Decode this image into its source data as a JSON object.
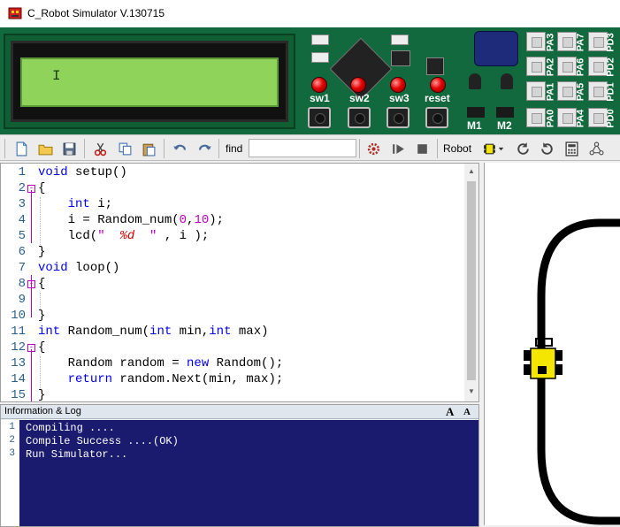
{
  "window": {
    "title": "C_Robot Simulator V.130715"
  },
  "board": {
    "switch_labels": [
      "sw1",
      "sw2",
      "sw3",
      "reset"
    ],
    "port_labels_top": [
      "PA3",
      "PA7",
      "PD3"
    ],
    "port_labels_mid": [
      "PA2",
      "PA6",
      "PD2"
    ],
    "port_labels_bottom": [
      "PA1",
      "PA5",
      "PD1"
    ],
    "port_labels_last": [
      "PA0",
      "PA4",
      "PD0"
    ],
    "motor_labels": [
      "M1",
      "M2"
    ],
    "lcd_cursor": "I"
  },
  "toolbar": {
    "find_label": "find",
    "find_value": "",
    "robot_label": "Robot"
  },
  "editor": {
    "line_numbers": [
      "1",
      "2",
      "3",
      "4",
      "5",
      "6",
      "7",
      "8",
      "9",
      "10",
      "11",
      "12",
      "13",
      "14",
      "15"
    ]
  },
  "log": {
    "title": "Information & Log",
    "font_up": "A",
    "font_down": "A",
    "lines": [
      {
        "n": "1",
        "text": "Compiling ...."
      },
      {
        "n": "2",
        "text": "Compile Success ....(OK)"
      },
      {
        "n": "3",
        "text": "Run Simulator..."
      }
    ]
  },
  "colors": {
    "board": "#12693d",
    "lcd": "#8fd35a",
    "log_bg": "#1a1a6e",
    "keyword": "#0000ee",
    "number": "#c000c0",
    "robot": "#f5e600"
  }
}
